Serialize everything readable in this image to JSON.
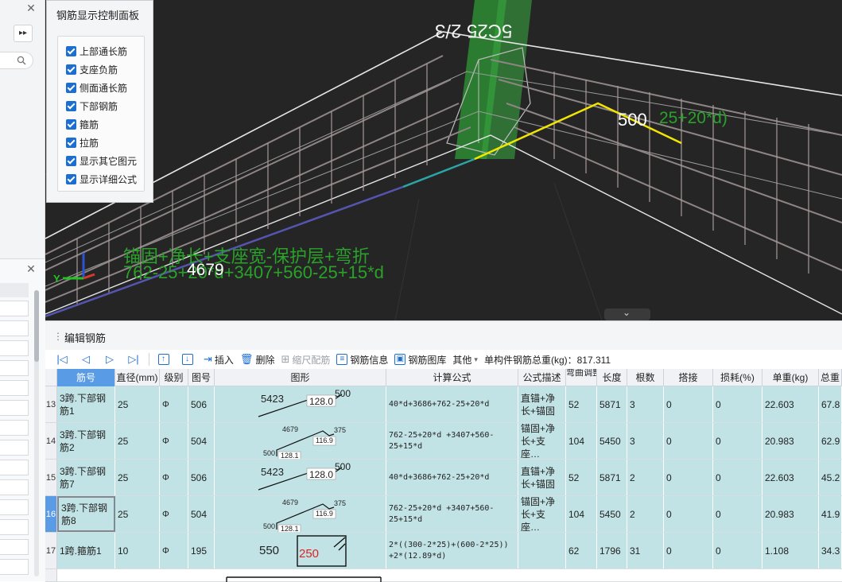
{
  "control_panel": {
    "title": "钢筋显示控制面板",
    "options": [
      {
        "label": "上部通长筋",
        "checked": true
      },
      {
        "label": "支座负筋",
        "checked": true
      },
      {
        "label": "侧面通长筋",
        "checked": true
      },
      {
        "label": "下部钢筋",
        "checked": true
      },
      {
        "label": "箍筋",
        "checked": true
      },
      {
        "label": "拉筋",
        "checked": true
      },
      {
        "label": "显示其它图元",
        "checked": true
      },
      {
        "label": "显示详细公式",
        "checked": true
      }
    ]
  },
  "left_panel": {
    "close_glyph": "✕",
    "expand_glyph": "▸▸"
  },
  "viewport": {
    "beam_label": "5C25 2/3",
    "anno_500": "500",
    "anno_right_formula": "25+20*d)",
    "anno_desc": "锚固+净长+支座宽-保护层+弯折",
    "anno_formula": "762-25+20*d+3407+560-25+15*d",
    "anno_4679": "4679",
    "axis_y": "Y",
    "collapse_glyph": "⌄"
  },
  "editor": {
    "title": "编辑钢筋",
    "toolbar": {
      "insert": "插入",
      "delete": "删除",
      "scale_rebar": "缩尺配筋",
      "rebar_info": "钢筋信息",
      "rebar_library": "钢筋图库",
      "other": "其他",
      "total_weight": "单构件钢筋总重(kg)：817.311"
    },
    "columns": [
      "筋号",
      "直径(mm)",
      "级别",
      "图号",
      "图形",
      "计算公式",
      "公式描述",
      "弯曲调整",
      "长度",
      "根数",
      "搭接",
      "损耗(%)",
      "单重(kg)",
      "总重"
    ],
    "rows": [
      {
        "no": "13",
        "name": "3跨.下部钢筋1",
        "dia": "25",
        "grade": "Φ",
        "fig": "506",
        "formula": "40*d+3686+762-25+20*d",
        "desc": "直锚+净长+锚固",
        "bend": "52",
        "len": "5871",
        "count": "3",
        "lap": "0",
        "loss": "0",
        "unit_w": "22.603",
        "total_w": "67.8",
        "shape": {
          "a": "5423",
          "b": "128.0",
          "c": "500"
        }
      },
      {
        "no": "14",
        "name": "3跨.下部钢筋2",
        "dia": "25",
        "grade": "Φ",
        "fig": "504",
        "formula": "762-25+20*d +3407+560-25+15*d",
        "desc": "锚固+净长+支座…",
        "bend": "104",
        "len": "5450",
        "count": "3",
        "lap": "0",
        "loss": "0",
        "unit_w": "20.983",
        "total_w": "62.9",
        "shape": {
          "a": "4679",
          "b": "375",
          "c": "116.9",
          "d": "500",
          "e": "128.1"
        }
      },
      {
        "no": "15",
        "name": "3跨.下部钢筋7",
        "dia": "25",
        "grade": "Φ",
        "fig": "506",
        "formula": "40*d+3686+762-25+20*d",
        "desc": "直锚+净长+锚固",
        "bend": "52",
        "len": "5871",
        "count": "2",
        "lap": "0",
        "loss": "0",
        "unit_w": "22.603",
        "total_w": "45.2",
        "shape": {
          "a": "5423",
          "b": "128.0",
          "c": "500"
        }
      },
      {
        "no": "16",
        "name": "3跨.下部钢筋8",
        "dia": "25",
        "grade": "Φ",
        "fig": "504",
        "formula": "762-25+20*d +3407+560-25+15*d",
        "desc": "锚固+净长+支座…",
        "bend": "104",
        "len": "5450",
        "count": "2",
        "lap": "0",
        "loss": "0",
        "unit_w": "20.983",
        "total_w": "41.9",
        "shape": {
          "a": "4679",
          "b": "375",
          "c": "116.9",
          "d": "500",
          "e": "128.1"
        }
      },
      {
        "no": "17",
        "name": "1跨.箍筋1",
        "dia": "10",
        "grade": "Φ",
        "fig": "195",
        "formula": "2*((300-2*25)+(600-2*25)) +2*(12.89*d)",
        "desc": "",
        "bend": "62",
        "len": "1796",
        "count": "31",
        "lap": "0",
        "loss": "0",
        "unit_w": "1.108",
        "total_w": "34.3",
        "shape": {
          "a": "550",
          "b": "250"
        }
      }
    ]
  }
}
